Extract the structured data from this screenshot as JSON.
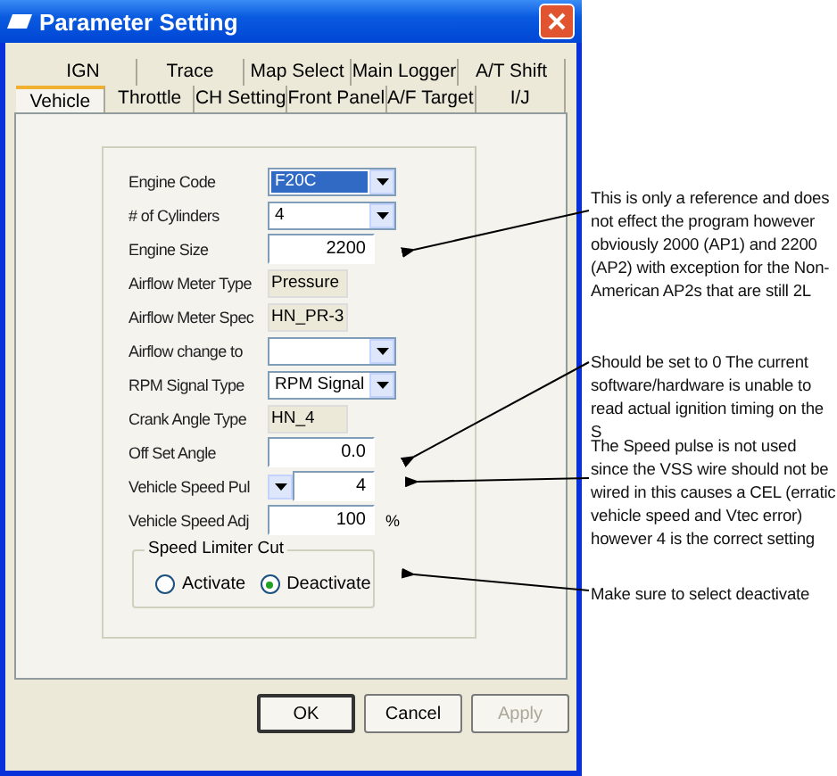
{
  "window": {
    "title": "Parameter Setting"
  },
  "tabs": [
    [
      {
        "label": "IGN",
        "selected": false
      },
      {
        "label": "Trace",
        "selected": false
      },
      {
        "label": "Map Select",
        "selected": false
      },
      {
        "label": "Main Logger",
        "selected": false
      },
      {
        "label": "A/T Shift",
        "selected": false
      }
    ],
    [
      {
        "label": "Vehicle",
        "selected": true
      },
      {
        "label": "Throttle",
        "selected": false
      },
      {
        "label": "CH Setting",
        "selected": false
      },
      {
        "label": "Front Panel",
        "selected": false
      },
      {
        "label": "A/F Target",
        "selected": false
      },
      {
        "label": "I/J",
        "selected": false
      }
    ]
  ],
  "fields": [
    {
      "kind": "dropdown",
      "label": "Engine Code",
      "value": "F20C",
      "highlighted": true
    },
    {
      "kind": "dropdown",
      "label": "# of Cylinders",
      "value": "4",
      "highlighted": false
    },
    {
      "kind": "input",
      "label": "Engine Size",
      "value": "2200"
    },
    {
      "kind": "readonly",
      "label": "Airflow Meter Type",
      "value": "Pressure"
    },
    {
      "kind": "readonly",
      "label": "Airflow Meter Spec",
      "value": "HN_PR-3"
    },
    {
      "kind": "dropdown",
      "label": "Airflow change to",
      "highlighted": false
    },
    {
      "kind": "dropdown",
      "label": "RPM Signal Type",
      "value": "RPM Signal",
      "highlighted": false
    },
    {
      "kind": "readonly",
      "label": "Crank Angle Type",
      "value": "HN_4"
    },
    {
      "kind": "input",
      "label": "Off Set Angle",
      "value": "0.0"
    },
    {
      "kind": "spinner",
      "label": "Vehicle Speed Pul",
      "value": "4"
    },
    {
      "kind": "input",
      "label": "Vehicle Speed Adj",
      "value": "100",
      "unit": "%"
    }
  ],
  "speed_limiter": {
    "title": "Speed Limiter Cut",
    "options": [
      {
        "label": "Activate",
        "selected": false
      },
      {
        "label": "Deactivate",
        "selected": true
      }
    ]
  },
  "buttons": [
    {
      "label": "OK",
      "disabled": false,
      "default": true
    },
    {
      "label": "Cancel",
      "disabled": false,
      "default": false
    },
    {
      "label": "Apply",
      "disabled": true,
      "default": false
    }
  ],
  "notes": [
    "This is only a reference and does not effect the program however obviously 2000 (AP1) and 2200 (AP2) with exception for the Non-American AP2s that are still 2L",
    "Should be set to 0 The current software/hardware is unable to read actual ignition timing on the S",
    "The Speed pulse is not used since the VSS wire should not be wired in  this causes a CEL (erratic vehicle speed and Vtec error) however 4 is the correct setting",
    "Make sure to select deactivate"
  ]
}
